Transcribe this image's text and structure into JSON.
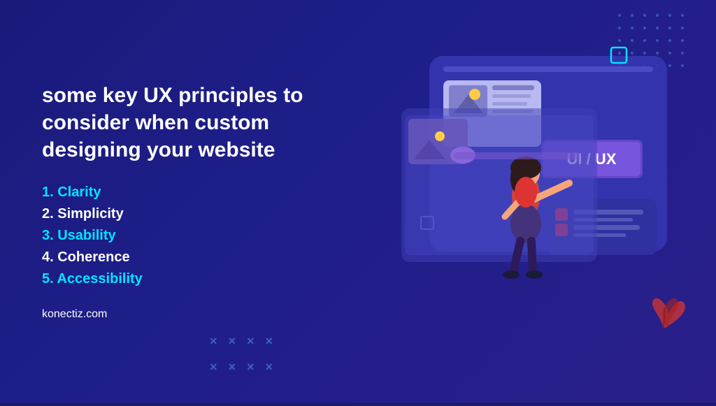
{
  "page": {
    "background_color": "#1a1a7a",
    "title": "some key UX principles to consider when custom designing your website",
    "principles": [
      {
        "number": "1",
        "label": "Clarity",
        "highlight": true
      },
      {
        "number": "2",
        "label": "Simplicity",
        "highlight": false
      },
      {
        "number": "3",
        "label": "Usability",
        "highlight": true
      },
      {
        "number": "4",
        "label": "Coherence",
        "highlight": false
      },
      {
        "number": "5",
        "label": "Accessibility",
        "highlight": true
      }
    ],
    "url": "konectiz.com",
    "ui_ux_badge": "UI / UX",
    "colors": {
      "cyan": "#00e5ff",
      "white": "#ffffff",
      "dark_blue": "#1a1a7a",
      "medium_blue": "#4040c0",
      "light_blue": "#6666dd",
      "purple": "#7b4fc8",
      "red": "#e63946"
    }
  }
}
